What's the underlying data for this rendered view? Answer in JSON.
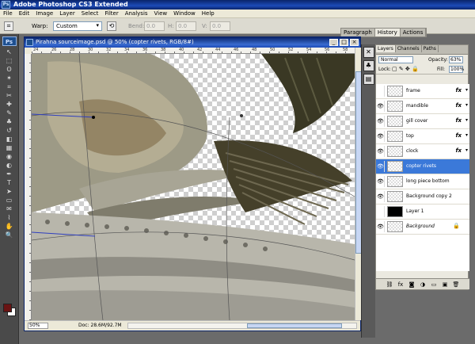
{
  "app": {
    "title": "Adobe Photoshop CS3 Extended",
    "logo": "Ps"
  },
  "menu": [
    "File",
    "Edit",
    "Image",
    "Layer",
    "Select",
    "Filter",
    "Analysis",
    "View",
    "Window",
    "Help"
  ],
  "options_bar": {
    "warp_label": "Warp:",
    "warp_value": "Custom",
    "bend_label": "Bend:",
    "bend_value": "0.0",
    "h_label": "H:",
    "h_value": "0.0",
    "v_label": "V:",
    "v_value": "0.0"
  },
  "palette_tabs": [
    "Paragraph",
    "History",
    "Actions"
  ],
  "toolbox": {
    "badge": "Ps",
    "tools": [
      "move-icon",
      "marquee-icon",
      "lasso-icon",
      "magic-wand-icon",
      "crop-icon",
      "slice-icon",
      "healing-icon",
      "brush-icon",
      "clone-stamp-icon",
      "history-brush-icon",
      "eraser-icon",
      "gradient-icon",
      "blur-icon",
      "dodge-icon",
      "pen-icon",
      "type-icon",
      "path-select-icon",
      "shape-icon",
      "notes-icon",
      "eyedropper-icon",
      "hand-icon",
      "zoom-icon"
    ],
    "tool_glyphs": [
      "↖",
      "⬚",
      "ʘ",
      "✶",
      "⌗",
      "✂",
      "✚",
      "✎",
      "♣",
      "↺",
      "◧",
      "▦",
      "◉",
      "◐",
      "✒",
      "T",
      "➤",
      "▭",
      "✉",
      "⌇",
      "✋",
      "🔍"
    ],
    "fg_color": "#6a1414",
    "bg_color": "#ffffff"
  },
  "document": {
    "title": "Pirahna sourceimage.psd @ 50% (copter rivets, RGB/8#)",
    "ruler_ticks": [
      "24",
      "26",
      "28",
      "30",
      "32",
      "34",
      "36",
      "38",
      "40",
      "42",
      "44",
      "46",
      "48",
      "50",
      "52",
      "54",
      "56",
      "58"
    ],
    "zoom": "50%",
    "doc_info": "Doc: 28.6M/92.7M"
  },
  "layers_panel": {
    "tabs": [
      "Layers",
      "Channels",
      "Paths"
    ],
    "blend_mode": "Normal",
    "opacity_label": "Opacity:",
    "opacity": "63%",
    "lock_label": "Lock:",
    "fill_label": "Fill:",
    "fill": "100%",
    "layers": [
      {
        "name": "frame",
        "visible": false,
        "fx": true,
        "selected": false
      },
      {
        "name": "mandible",
        "visible": true,
        "fx": true,
        "selected": false
      },
      {
        "name": "gill cover",
        "visible": true,
        "fx": true,
        "selected": false
      },
      {
        "name": "top",
        "visible": true,
        "fx": true,
        "selected": false
      },
      {
        "name": "clock",
        "visible": true,
        "fx": true,
        "selected": false
      },
      {
        "name": "copter rivets",
        "visible": true,
        "fx": false,
        "selected": true
      },
      {
        "name": "long piece bottom",
        "visible": true,
        "fx": false,
        "selected": false
      },
      {
        "name": "Background copy 2",
        "visible": true,
        "fx": false,
        "selected": false
      },
      {
        "name": "Layer 1",
        "visible": false,
        "fx": false,
        "selected": false
      },
      {
        "name": "Background",
        "visible": true,
        "fx": false,
        "selected": false,
        "locked": true
      }
    ],
    "fx_glyph": "fx",
    "eye_glyph": "👁",
    "lock_glyph": "🔒"
  }
}
